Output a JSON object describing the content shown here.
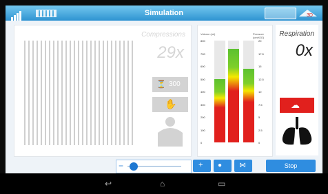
{
  "header": {
    "title": "Simulation"
  },
  "compression": {
    "label": "Compressions",
    "value": "29x",
    "rate_label": "300"
  },
  "respiration": {
    "label": "Respiration",
    "value": "0x"
  },
  "controls": {
    "stop_label": "Stop",
    "slider_level": 0.12
  },
  "gauges": {
    "left_label": "Volume\n(ml)",
    "right_label": "Pressure\n(cmH2O)",
    "left_ticks": [
      "800",
      "700",
      "600",
      "500",
      "400",
      "300",
      "200",
      "100",
      "0"
    ],
    "right_ticks": [
      "20",
      "17.5",
      "15",
      "12.5",
      "10",
      "7.5",
      "5",
      "2.5",
      "0"
    ],
    "fills": [
      0.62,
      0.92,
      0.72
    ]
  },
  "colors": {
    "accent": "#2f8de0",
    "red": "#e1201d",
    "green": "#5cc12f",
    "yellow": "#f5e800"
  }
}
